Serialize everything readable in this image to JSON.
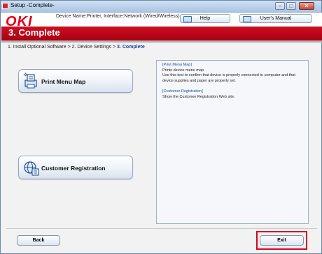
{
  "window": {
    "title": "Setup -Complete-",
    "minimize": "–",
    "maximize": "□",
    "close": "✕"
  },
  "header": {
    "logo": "OKI",
    "device_name": "Device Name:Printer, Interface:Network (Wired/Wireless)",
    "help_label": "Help",
    "manual_label": "User's Manual"
  },
  "banner": {
    "title": "3. Complete"
  },
  "breadcrumb": {
    "step1": "1. Install Optional Software",
    "sep1": " > ",
    "step2": "2. Device Settings",
    "sep2": " > ",
    "current": "3. Complete"
  },
  "actions": {
    "print_menu_map": "Print Menu Map",
    "customer_registration": "Customer Registration"
  },
  "description": {
    "pmm_head": "[Print Menu Map]",
    "pmm_line1": "Prints device menu map.",
    "pmm_line2": "Use this test to confirm that device is properly connected to computer and that device supplies and paper are properly set.",
    "cr_head": "[Customer Registration]",
    "cr_line1": "Show the Customer Registration Web site."
  },
  "footer": {
    "back_label": "Back",
    "exit_label": "Exit"
  },
  "colors": {
    "brand_red": "#e3001b",
    "banner_red": "#c0081a",
    "highlight": "#e0001b"
  }
}
